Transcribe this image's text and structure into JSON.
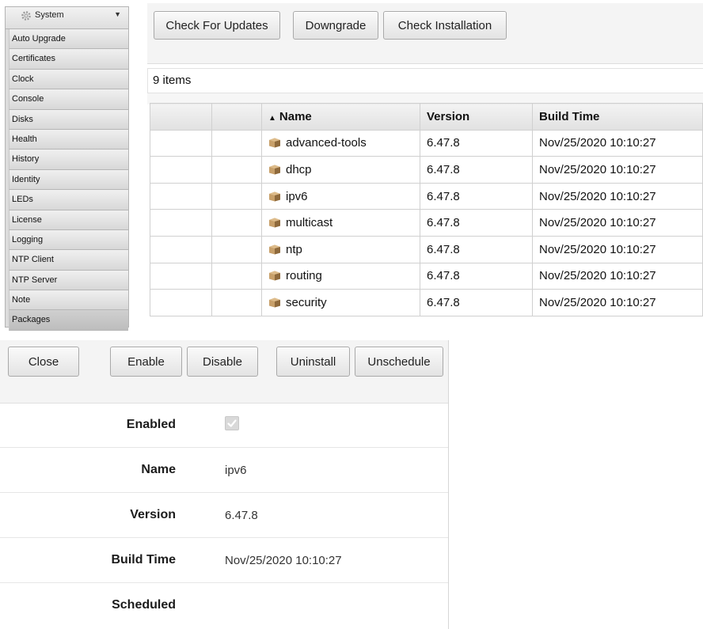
{
  "sidebar": {
    "header": "System",
    "items": [
      {
        "label": "Auto Upgrade"
      },
      {
        "label": "Certificates"
      },
      {
        "label": "Clock"
      },
      {
        "label": "Console"
      },
      {
        "label": "Disks"
      },
      {
        "label": "Health"
      },
      {
        "label": "History"
      },
      {
        "label": "Identity"
      },
      {
        "label": "LEDs"
      },
      {
        "label": "License"
      },
      {
        "label": "Logging"
      },
      {
        "label": "NTP Client"
      },
      {
        "label": "NTP Server"
      },
      {
        "label": "Note"
      },
      {
        "label": "Packages",
        "active": true
      }
    ]
  },
  "toolbar": {
    "check_updates": "Check For Updates",
    "downgrade": "Downgrade",
    "check_installation": "Check Installation"
  },
  "list": {
    "count_text": "9 items",
    "columns": {
      "name": "Name",
      "version": "Version",
      "build_time": "Build Time"
    },
    "sort_indicator": "▲",
    "rows": [
      {
        "name": "advanced-tools",
        "version": "6.47.8",
        "build_time": "Nov/25/2020 10:10:27"
      },
      {
        "name": "dhcp",
        "version": "6.47.8",
        "build_time": "Nov/25/2020 10:10:27"
      },
      {
        "name": "ipv6",
        "version": "6.47.8",
        "build_time": "Nov/25/2020 10:10:27"
      },
      {
        "name": "multicast",
        "version": "6.47.8",
        "build_time": "Nov/25/2020 10:10:27"
      },
      {
        "name": "ntp",
        "version": "6.47.8",
        "build_time": "Nov/25/2020 10:10:27"
      },
      {
        "name": "routing",
        "version": "6.47.8",
        "build_time": "Nov/25/2020 10:10:27"
      },
      {
        "name": "security",
        "version": "6.47.8",
        "build_time": "Nov/25/2020 10:10:27"
      }
    ]
  },
  "detail": {
    "buttons": {
      "close": "Close",
      "enable": "Enable",
      "disable": "Disable",
      "uninstall": "Uninstall",
      "unschedule": "Unschedule"
    },
    "fields": {
      "enabled_label": "Enabled",
      "enabled_checked": true,
      "name_label": "Name",
      "name_value": "ipv6",
      "version_label": "Version",
      "version_value": "6.47.8",
      "build_time_label": "Build Time",
      "build_time_value": "Nov/25/2020 10:10:27",
      "scheduled_label": "Scheduled",
      "scheduled_value": ""
    }
  },
  "colors": {
    "package_icon": "#c8a06a",
    "package_icon_dark": "#8f6a3c"
  }
}
